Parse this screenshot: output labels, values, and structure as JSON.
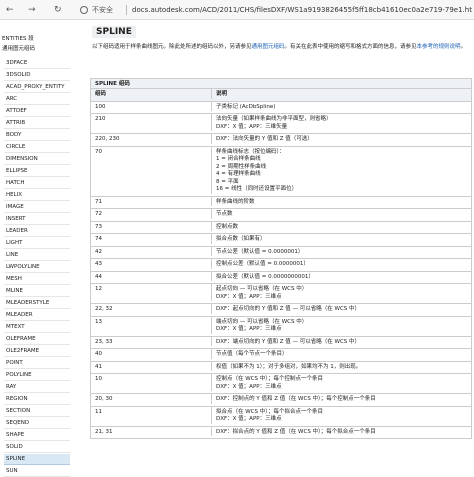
{
  "browser": {
    "back": "←",
    "forward": "→",
    "reload": "↻",
    "security_label": "不安全",
    "url": "docs.autodesk.com/ACD/2011/CHS/filesDXF/WS1a9193826455f5ff18cb41610ec0a2e719-79e1.htm"
  },
  "sidebar": {
    "header": "ENTITIES 段",
    "sub": "通用图元组码",
    "items": [
      "3DFACE",
      "3DSOLID",
      "ACAD_PROXY_ENTITY",
      "ARC",
      "ATTDEF",
      "ATTRIB",
      "BODY",
      "CIRCLE",
      "DIMENSION",
      "ELLIPSE",
      "HATCH",
      "HELIX",
      "IMAGE",
      "INSERT",
      "LEADER",
      "LIGHT",
      "LINE",
      "LWPOLYLINE",
      "MESH",
      "MLINE",
      "MLEADERSTYLE",
      "MLEADER",
      "MTEXT",
      "OLEFRAME",
      "OLE2FRAME",
      "POINT",
      "POLYLINE",
      "RAY",
      "REGION",
      "SECTION",
      "SEQEND",
      "SHAPE",
      "SOLID",
      "SPLINE",
      "SUN"
    ],
    "selected": "SPLINE"
  },
  "main": {
    "title": "SPLINE",
    "intro_a": "以下组码适用于样条曲线图元。除此处所述的组码以外，另请参见",
    "intro_link1": "通用图元组码",
    "intro_b": "。有关在此表中使用的缩写和格式方面的信息，请参见",
    "intro_link2": "本参考的规则说明",
    "intro_c": "。",
    "table_caption": "SPLINE 组码",
    "col1": "组码",
    "col2": "说明",
    "rows": [
      {
        "code": "100",
        "desc": [
          "子类标记 (AcDbSpline)"
        ]
      },
      {
        "code": "210",
        "desc": [
          "法向矢量（如果样条曲线为非平面型，则省略）",
          "DXF：X 值；APP：三维矢量"
        ]
      },
      {
        "code": "220, 230",
        "desc": [
          "DXF：法向矢量的 Y 值和 Z 值（可选）"
        ]
      },
      {
        "code": "70",
        "desc": [
          "样条曲线标志（按位编码）：",
          "1 = 闭合样条曲线",
          "2 = 周期性样条曲线",
          "4 = 有理样条曲线",
          "8 = 平面",
          "16 = 线性（同时还设置平面位）"
        ]
      },
      {
        "code": "71",
        "desc": [
          "样条曲线的阶数"
        ]
      },
      {
        "code": "72",
        "desc": [
          "节点数"
        ]
      },
      {
        "code": "73",
        "desc": [
          "控制点数"
        ]
      },
      {
        "code": "74",
        "desc": [
          "拟合点数（如果有）"
        ]
      },
      {
        "code": "42",
        "desc": [
          "节点公差（默认值 = 0.0000001）"
        ]
      },
      {
        "code": "43",
        "desc": [
          "控制点公差（默认值 = 0.0000001）"
        ]
      },
      {
        "code": "44",
        "desc": [
          "拟合公差（默认值 = 0.0000000001）"
        ]
      },
      {
        "code": "12",
        "desc": [
          "起点切向 — 可以省略（在 WCS 中）",
          "DXF：X 值；APP：三维点"
        ]
      },
      {
        "code": "22, 32",
        "desc": [
          "DXF：起点切向的 Y 值和 Z 值 — 可以省略（在 WCS 中）"
        ]
      },
      {
        "code": "13",
        "desc": [
          "端点切向 — 可以省略（在 WCS 中）",
          "DXF：X 值；APP：三维点"
        ]
      },
      {
        "code": "23, 33",
        "desc": [
          "DXF：端点切向的 Y 值和 Z 值 — 可以省略（在 WCS 中）"
        ]
      },
      {
        "code": "40",
        "desc": [
          "节点值（每个节点一个条目）"
        ]
      },
      {
        "code": "41",
        "desc": [
          "权值（如果不为 1）；对于多组对，如果均不为 1，则出现。"
        ]
      },
      {
        "code": "10",
        "desc": [
          "控制点（在 WCS 中）；每个控制点一个条目",
          "DXF：X 值；APP：三维点"
        ]
      },
      {
        "code": "20, 30",
        "desc": [
          "DXF：控制点的 Y 值和 Z 值（在 WCS 中）；每个控制点一个条目"
        ]
      },
      {
        "code": "11",
        "desc": [
          "拟合点（在 WCS 中）；每个拟合点一个条目",
          "DXF：X 值；APP：三维点"
        ]
      },
      {
        "code": "21, 31",
        "desc": [
          "DXF：拟合点的 Y 值和 Z 值（在 WCS 中）；每个拟合点一个条目"
        ]
      }
    ]
  }
}
